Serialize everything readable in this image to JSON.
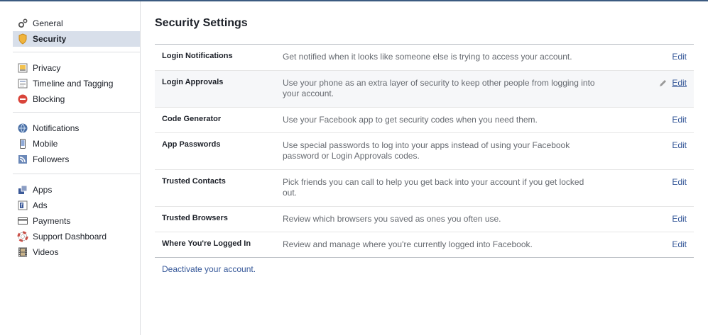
{
  "sidebar": {
    "groups": [
      [
        {
          "label": "General",
          "icon": "gear-icon"
        },
        {
          "label": "Security",
          "icon": "badge-icon",
          "active": true
        }
      ],
      [
        {
          "label": "Privacy",
          "icon": "lock-icon"
        },
        {
          "label": "Timeline and Tagging",
          "icon": "timeline-icon"
        },
        {
          "label": "Blocking",
          "icon": "block-icon"
        }
      ],
      [
        {
          "label": "Notifications",
          "icon": "globe-icon"
        },
        {
          "label": "Mobile",
          "icon": "phone-icon"
        },
        {
          "label": "Followers",
          "icon": "rss-icon"
        }
      ],
      [
        {
          "label": "Apps",
          "icon": "apps-icon"
        },
        {
          "label": "Ads",
          "icon": "ads-icon"
        },
        {
          "label": "Payments",
          "icon": "card-icon"
        },
        {
          "label": "Support Dashboard",
          "icon": "lifebuoy-icon"
        },
        {
          "label": "Videos",
          "icon": "film-icon"
        }
      ]
    ]
  },
  "main": {
    "title": "Security Settings",
    "rows": [
      {
        "name": "Login Notifications",
        "description": "Get notified when it looks like someone else is trying to access your account.",
        "edit": "Edit"
      },
      {
        "name": "Login Approvals",
        "description": "Use your phone as an extra layer of security to keep other people from logging into your account.",
        "edit": "Edit",
        "hover": true
      },
      {
        "name": "Code Generator",
        "description": "Use your Facebook app to get security codes when you need them.",
        "edit": "Edit"
      },
      {
        "name": "App Passwords",
        "description": "Use special passwords to log into your apps instead of using your Facebook password or Login Approvals codes.",
        "edit": "Edit"
      },
      {
        "name": "Trusted Contacts",
        "description": "Pick friends you can call to help you get back into your account if you get locked out.",
        "edit": "Edit"
      },
      {
        "name": "Trusted Browsers",
        "description": "Review which browsers you saved as ones you often use.",
        "edit": "Edit"
      },
      {
        "name": "Where You're Logged In",
        "description": "Review and manage where you're currently logged into Facebook.",
        "edit": "Edit"
      }
    ],
    "deactivate": "Deactivate your account."
  },
  "colors": {
    "link": "#365899",
    "active_bg": "#d8dfea",
    "hover_bg": "#f6f7f9",
    "top_border": "#3b5a80"
  }
}
